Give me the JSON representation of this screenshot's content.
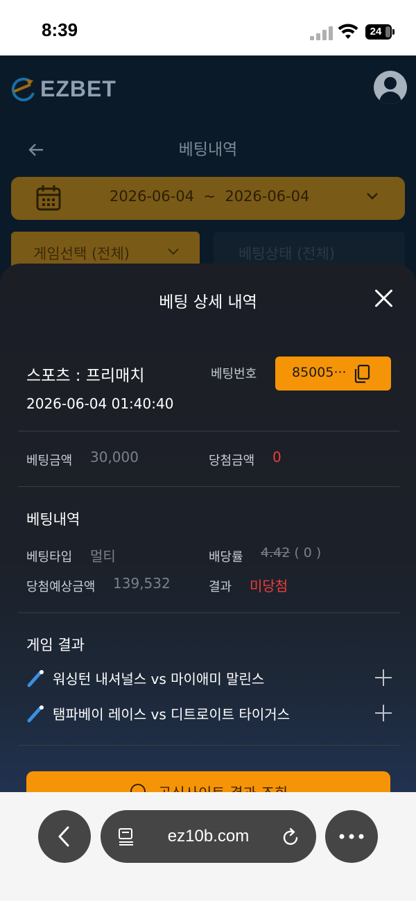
{
  "status_bar": {
    "time": "8:39",
    "battery": "24"
  },
  "app": {
    "logo_text": "EZBET",
    "page_title": "베팅내역",
    "date_range": "2026-06-04  ~  2026-06-04",
    "game_filter": "게임선택 (전체)",
    "status_filter": "베팅상태 (전체)"
  },
  "sheet": {
    "title": "베팅 상세 내역",
    "category": "스포츠 : 프리매치",
    "datetime": "2026-06-04 01:40:40",
    "bet_number_label": "베팅번호",
    "bet_number_value": "85005···",
    "bet_amount_label": "베팅금액",
    "bet_amount_value": "30,000",
    "win_amount_label": "당첨금액",
    "win_amount_value": "0",
    "details_title": "베팅내역",
    "bet_type_label": "베팅타입",
    "bet_type_value": "멀티",
    "odds_label": "배당률",
    "odds_value": "4.42",
    "odds_paren": " ( 0 )",
    "expected_label": "당첨예상금액",
    "expected_value": "139,532",
    "result_label": "결과",
    "result_value": "미당첨",
    "games_title": "게임 결과",
    "games": [
      {
        "name": "워싱턴 내셔널스 vs 마이애미 말린스"
      },
      {
        "name": "탬파베이 레이스 vs 디트로이트 타이거스"
      }
    ],
    "official_button": "공식사이트 결과 조회"
  },
  "browser": {
    "url": "ez10b.com"
  },
  "colors": {
    "accent": "#f69407",
    "loss_red": "#ef3b3b",
    "sheet_bg": "#1c2028"
  }
}
